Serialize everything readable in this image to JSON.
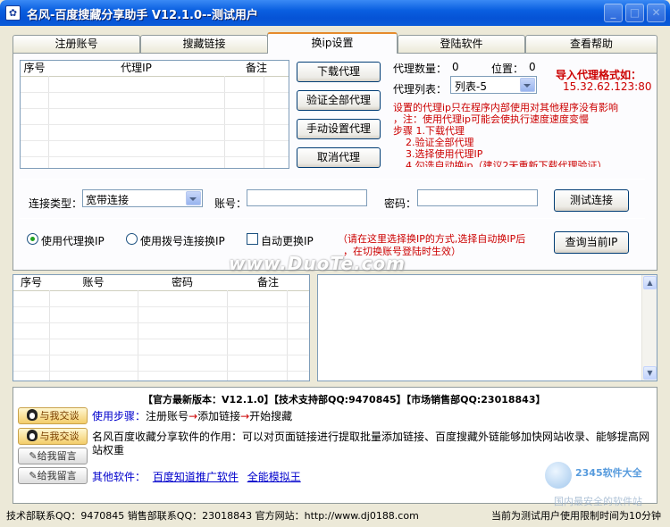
{
  "window": {
    "title": "名风-百度搜藏分享助手 V12.1.0--测试用户",
    "icon_name": "paw-app-icon",
    "controls": [
      "minimize-icon",
      "maximize-icon",
      "close-icon"
    ]
  },
  "tabs": [
    {
      "label": "注册账号",
      "active": false
    },
    {
      "label": "搜藏链接",
      "active": false
    },
    {
      "label": "换ip设置",
      "active": true
    },
    {
      "label": "登陆软件",
      "active": false
    },
    {
      "label": "查看帮助",
      "active": false
    }
  ],
  "proxy_list": {
    "headers": [
      "序号",
      "代理IP",
      "备注"
    ]
  },
  "proxy_buttons": {
    "download": "下载代理",
    "verify_all": "验证全部代理",
    "manual": "手动设置代理",
    "cancel": "取消代理"
  },
  "proxy_info": {
    "count_label": "代理数量：",
    "count_value": "0",
    "position_label": "位置：",
    "position_value": "0",
    "list_label": "代理列表：",
    "list_selected": "列表-5",
    "import_title": "导入代理格式如：",
    "import_example": "15.32.62.123:80"
  },
  "notes": [
    "设置的代理ip只在程序内部使用对其他程序没有影响",
    "，注：使用代理ip可能会使执行速度速度变慢",
    "步骤 1.下载代理",
    "2.验证全部代理",
    "3.选择使用代理IP",
    "4.勾选自动换ip（建议2天重新下载代理验证）"
  ],
  "connection": {
    "type_label": "连接类型：",
    "type_value": "宽带连接",
    "account_label": "账号：",
    "account_value": "",
    "password_label": "密码：",
    "password_value": "",
    "test_button": "测试连接"
  },
  "modes": {
    "proxy_radio": "使用代理换IP",
    "dial_radio": "使用拨号连接换IP",
    "auto_check": "自动更换IP",
    "hint_line1": "（请在这里选择换IP的方式,选择自动换IP后",
    "hint_line2": "，在切换账号登陆时生效）",
    "query_button": "查询当前IP",
    "proxy_selected": true,
    "auto_checked": false
  },
  "account_list": {
    "headers": [
      "序号",
      "账号",
      "密码",
      "备注"
    ]
  },
  "info": {
    "banner": "【官方最新版本：V12.1.0】【技术支持部QQ:9470845】【市场销售部QQ:23018843】",
    "qq_button_1": "与我交谈",
    "qq_button_2": "与我交谈",
    "msg_button_1": "给我留言",
    "msg_button_2": "给我留言",
    "usage_label": "使用步骤：",
    "usage_steps": [
      "注册账号",
      "添加链接",
      "开始搜藏"
    ],
    "arrow": "→",
    "desc_line1": "名风百度收藏分享软件的作用：可以对页面链接进行提取批量添加链接、百度搜藏外链能够加快网站收录、能够提高网",
    "desc_line2": "站权重",
    "other_label": "其他软件：",
    "other_links": [
      "百度知道推广软件",
      "全能模拟王"
    ]
  },
  "watermarks": {
    "center": "www.DuoTe.com",
    "corner_brand": "2345软件大全",
    "corner_sub": "国内最安全的软件站"
  },
  "status": {
    "left": "技术部联系QQ：9470845   销售部联系QQ：23018843  官方网站：http://www.dj0188.com",
    "right": "当前为测试用户使用限制时间为10分钟"
  },
  "colors": {
    "titlebar": "#0653d6",
    "active_tab_accent": "#e68b2c",
    "note_red": "#cc0000",
    "link_blue": "#0000cc"
  }
}
